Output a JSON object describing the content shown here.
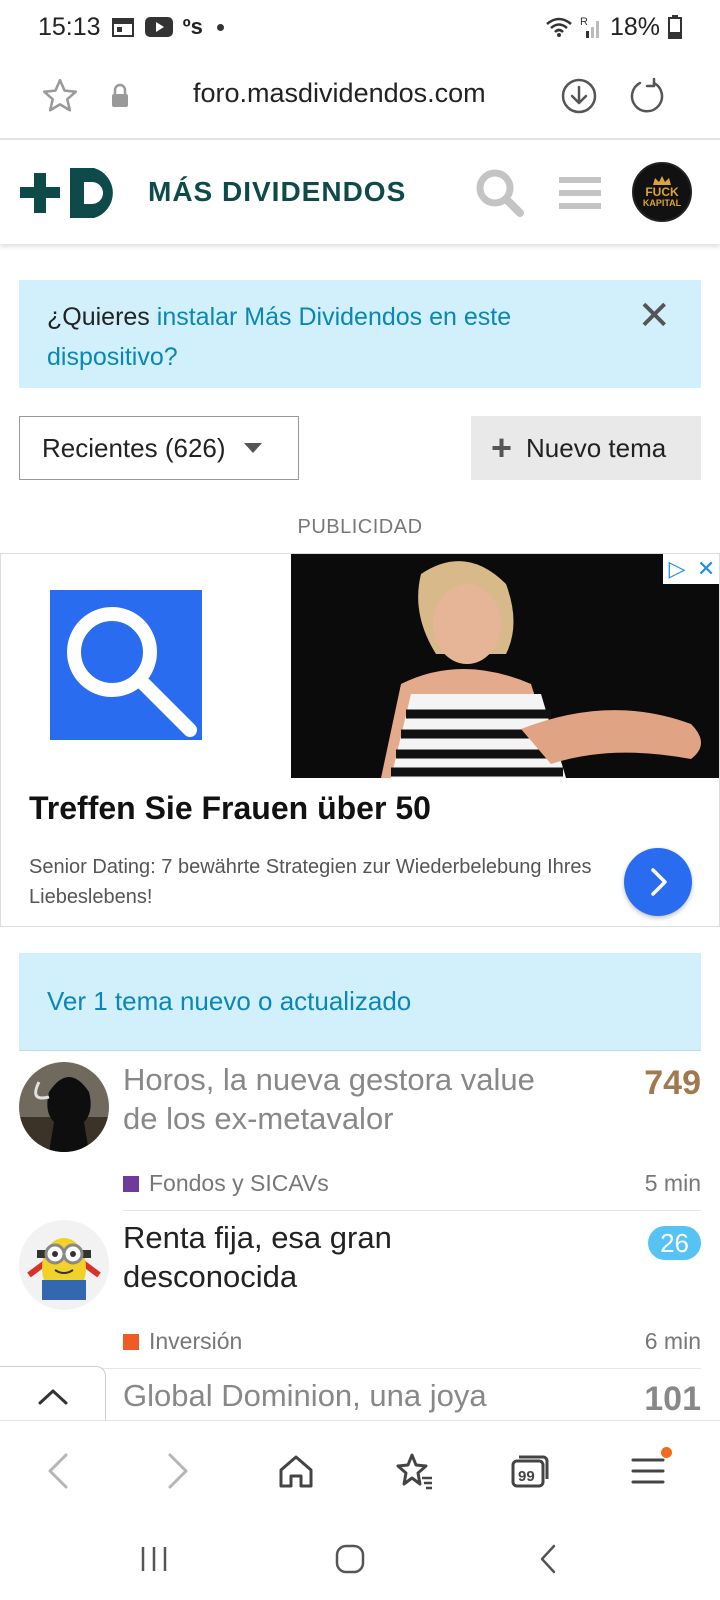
{
  "status_bar": {
    "time": "15:13",
    "battery": "18%"
  },
  "browser": {
    "url": "foro.masdividendos.com"
  },
  "site": {
    "logo_text": "MÁS DIVIDENDOS",
    "avatar_line1": "FUCK",
    "avatar_line2": "KAPITAL"
  },
  "install_banner": {
    "prefix": "¿Quieres ",
    "link": "instalar Más Dividendos en este dispositivo?",
    "close": "✕"
  },
  "controls": {
    "filter_label": "Recientes (626)",
    "new_topic_label": "Nuevo tema"
  },
  "ad": {
    "label": "PUBLICIDAD",
    "title": "Treffen Sie Frauen über 50",
    "description": "Senior Dating: 7 bewährte Strategien zur Wiederbelebung Ihres Liebeslebens!"
  },
  "new_topics_banner": "Ver 1 tema nuevo o actualizado",
  "topics": [
    {
      "title": "Horos, la nueva gestora value de los ex-metavalor",
      "count": "749",
      "category": "Fondos y SICAVs",
      "category_color": "#6f3a99",
      "age": "5 min"
    },
    {
      "title": "Renta fija, esa gran desconocida",
      "count": "26",
      "category": "Inversión",
      "category_color": "#f05a24",
      "age": "6 min"
    },
    {
      "title": "Global Dominion, una joya",
      "count": "101"
    }
  ],
  "colors": {
    "accent": "#0a87b5",
    "banner_bg": "#d1f0fb",
    "brand": "#0e4a4a",
    "count_hot": "#a07a4e",
    "badge": "#56c3f3"
  }
}
